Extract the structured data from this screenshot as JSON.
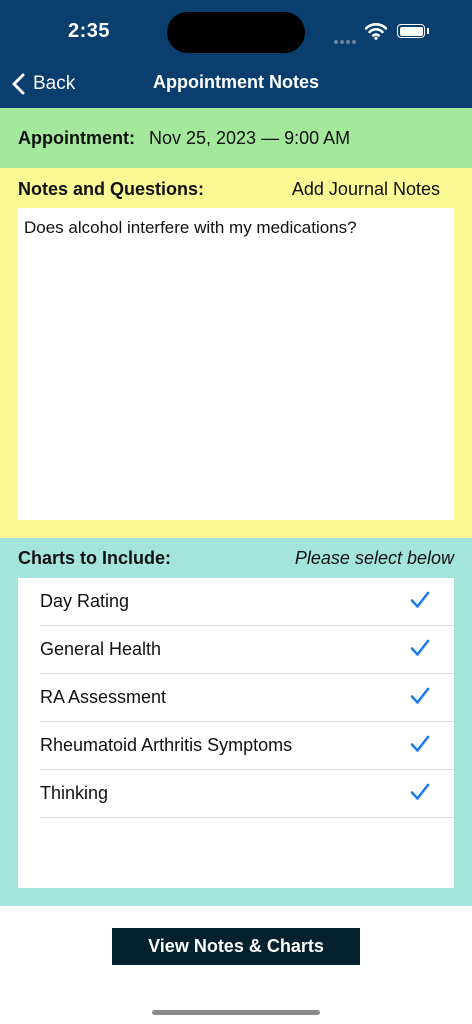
{
  "status_bar": {
    "time": "2:35"
  },
  "nav": {
    "back_label": "Back",
    "title": "Appointment Notes"
  },
  "appointment": {
    "label": "Appointment:",
    "value": "Nov 25, 2023 — 9:00 AM"
  },
  "notes": {
    "label": "Notes and Questions:",
    "journal_link": "Add Journal Notes",
    "text": "Does alcohol interfere with my medications?"
  },
  "charts": {
    "label": "Charts to Include:",
    "hint": "Please select below",
    "items": [
      {
        "label": "Day Rating",
        "checked": true
      },
      {
        "label": "General Health",
        "checked": true
      },
      {
        "label": "RA Assessment",
        "checked": true
      },
      {
        "label": "Rheumatoid Arthritis Symptoms",
        "checked": true
      },
      {
        "label": "Thinking",
        "checked": true
      }
    ]
  },
  "action": {
    "view_label": "View Notes & Charts"
  },
  "colors": {
    "header": "#093e6e",
    "appointment_bg": "#a3e89b",
    "notes_bg": "#faf993",
    "charts_bg": "#a3e4dc",
    "button_bg": "#04222e",
    "check": "#1a7cf0"
  }
}
